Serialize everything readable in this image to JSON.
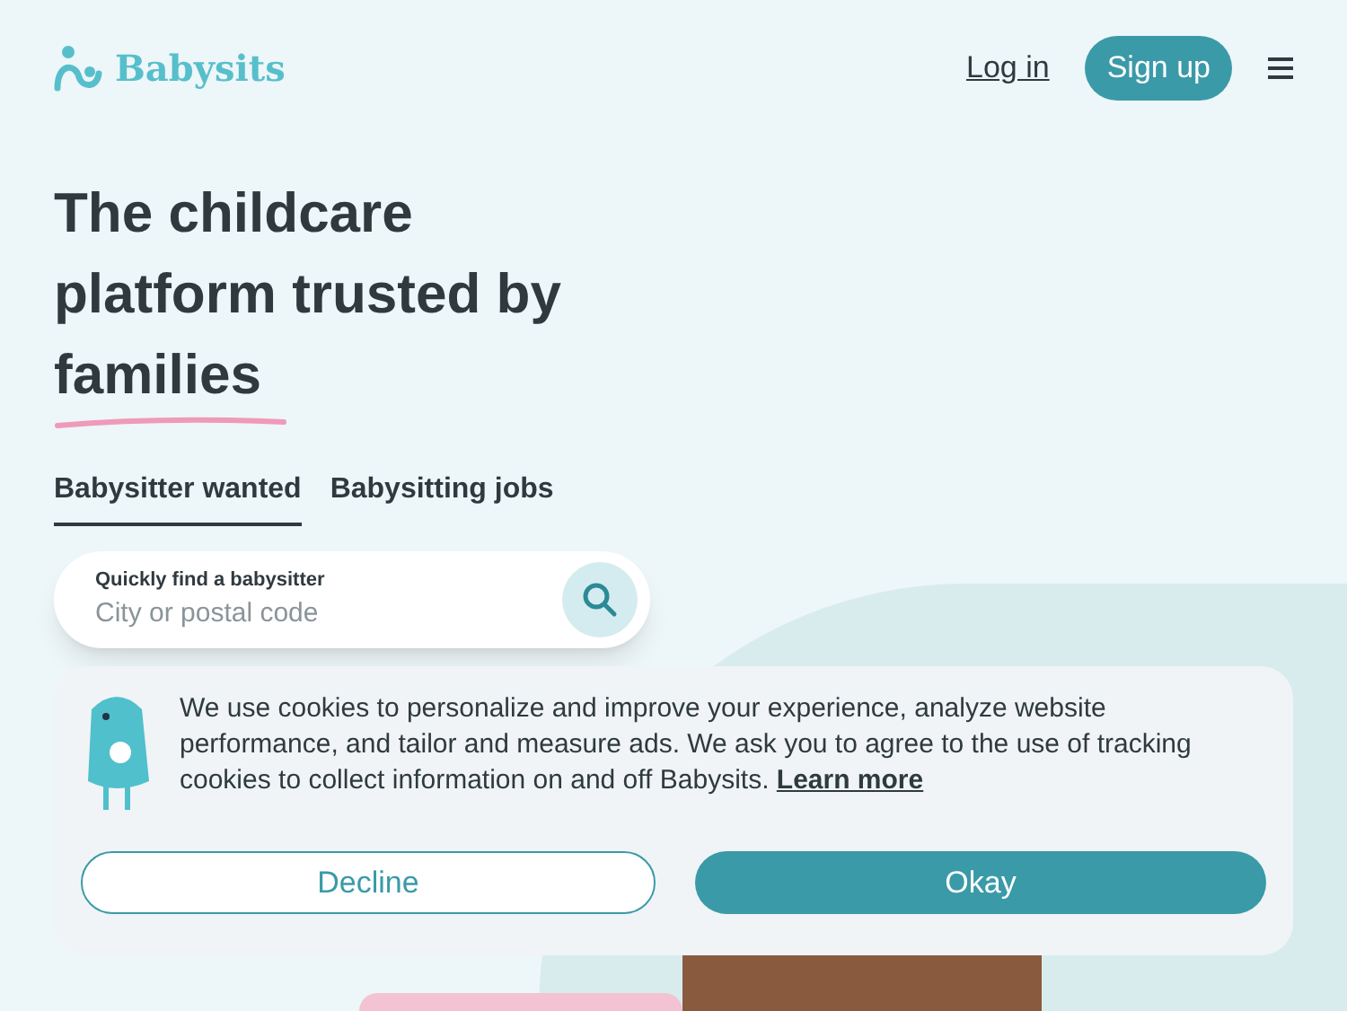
{
  "header": {
    "logo": "Babysits",
    "login": "Log in",
    "signup": "Sign up"
  },
  "hero": {
    "title": "The childcare platform trusted by",
    "highlight": "families"
  },
  "tabs": [
    {
      "label": "Babysitter wanted",
      "selected": true
    },
    {
      "label": "Babysitting jobs",
      "selected": false
    }
  ],
  "search": {
    "label": "Quickly find a babysitter",
    "placeholder": "City or postal code"
  },
  "cookie_banner": {
    "text": "We use cookies to personalize and improve your experience, analyze website performance, and tailor and measure ads. We ask you to agree to the use of tracking cookies to collect information on and off Babysits.",
    "link": "Learn more",
    "buttons": [
      {
        "label": "Decline",
        "kind": "outline"
      },
      {
        "label": "Okay",
        "kind": "primary"
      }
    ]
  }
}
